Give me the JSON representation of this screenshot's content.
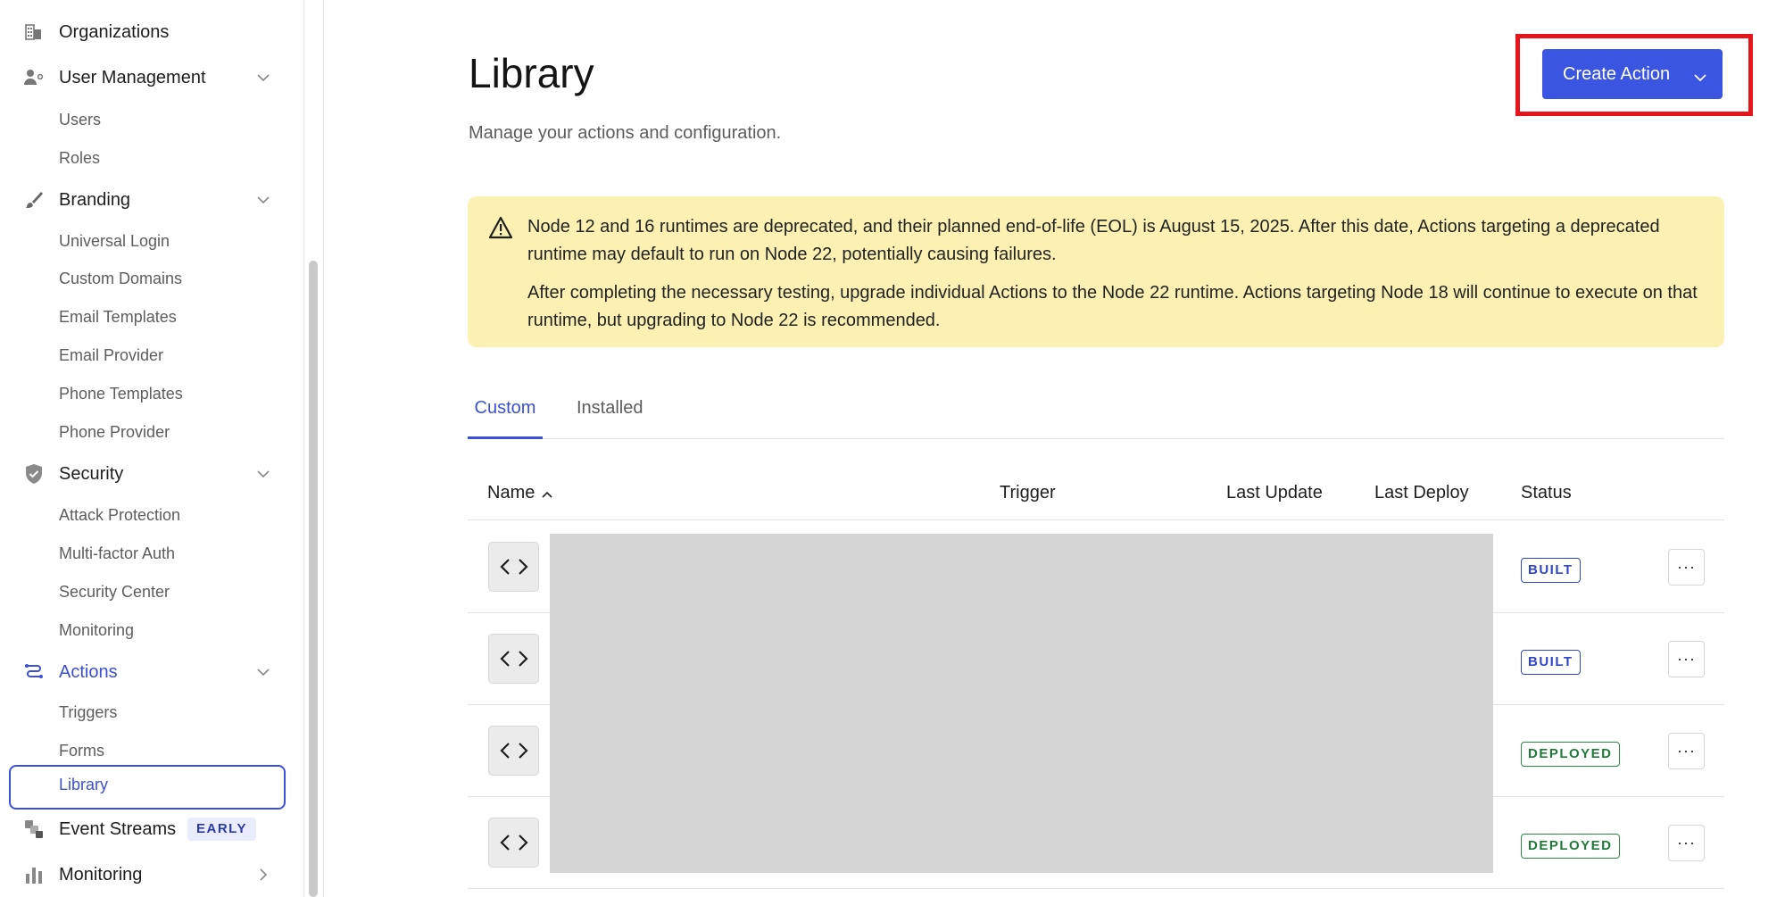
{
  "sidebar": {
    "groups": [
      {
        "label": "Organizations",
        "icon": "organization-icon"
      },
      {
        "label": "User Management",
        "icon": "user-management-icon"
      },
      {
        "label": "Branding",
        "icon": "brush-icon"
      },
      {
        "label": "Security",
        "icon": "shield-icon"
      },
      {
        "label": "Actions",
        "icon": "actions-icon"
      },
      {
        "label": "Event Streams",
        "icon": "event-streams-icon"
      },
      {
        "label": "Monitoring",
        "icon": "monitoring-bar-icon"
      }
    ],
    "user_management_items": [
      "Users",
      "Roles"
    ],
    "branding_items": [
      "Universal Login",
      "Custom Domains",
      "Email Templates",
      "Email Provider",
      "Phone Templates",
      "Phone Provider"
    ],
    "security_items": [
      "Attack Protection",
      "Multi-factor Auth",
      "Security Center",
      "Monitoring"
    ],
    "actions_items": [
      "Triggers",
      "Forms",
      "Library"
    ],
    "event_streams_badge": "EARLY"
  },
  "header": {
    "title": "Library",
    "subtitle": "Manage your actions and configuration.",
    "create_button_label": "Create Action"
  },
  "alert": {
    "line1": "Node 12 and 16 runtimes are deprecated, and their planned end-of-life (EOL) is August 15, 2025. After this date, Actions targeting a deprecated runtime may default to run on Node 22, potentially causing failures.",
    "line2": "After completing the necessary testing, upgrade individual Actions to the Node 22 runtime. Actions targeting Node 18 will continue to execute on that runtime, but upgrading to Node 22 is recommended."
  },
  "tabs": [
    "Custom",
    "Installed"
  ],
  "table": {
    "columns": [
      "Name",
      "Trigger",
      "Last Update",
      "Last Deploy",
      "Status"
    ],
    "rows": [
      {
        "status": "BUILT",
        "more": "···"
      },
      {
        "status": "BUILT",
        "more": "···"
      },
      {
        "status": "DEPLOYED",
        "more": "···"
      },
      {
        "status": "DEPLOYED",
        "more": "···"
      }
    ]
  },
  "colors": {
    "accent": "#3a55e0",
    "alert_bg": "#fcf1b3",
    "highlight": "#e8141b",
    "built": "#2f46c9",
    "deployed": "#1f7a3a"
  }
}
